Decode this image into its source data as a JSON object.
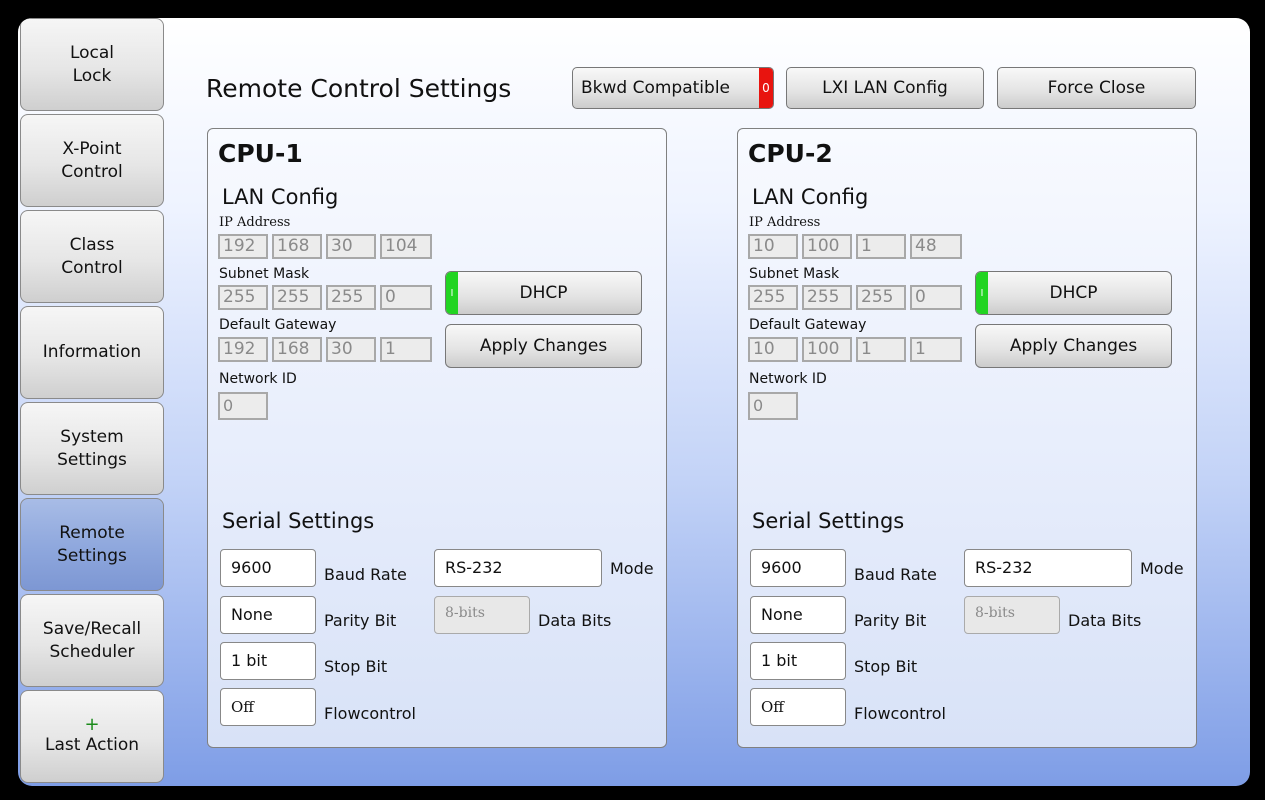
{
  "nav": {
    "items": [
      {
        "label1": "Local",
        "label2": "Lock"
      },
      {
        "label1": "X-Point",
        "label2": "Control"
      },
      {
        "label1": "Class",
        "label2": "Control"
      },
      {
        "label1": "Information",
        "label2": ""
      },
      {
        "label1": "System",
        "label2": "Settings"
      },
      {
        "label1": "Remote",
        "label2": "Settings"
      },
      {
        "label1": "Save/Recall",
        "label2": "Scheduler"
      },
      {
        "label1": "+",
        "label2": "Last Action"
      }
    ],
    "active_index": 5
  },
  "header": {
    "title": "Remote Control Settings",
    "bkwd_label": "Bkwd Compatible",
    "bkwd_indicator": "0",
    "lxi_label": "LXI LAN Config",
    "force_close_label": "Force Close"
  },
  "labels": {
    "lan_config": "LAN Config",
    "ip_address": "IP Address",
    "subnet_mask": "Subnet Mask",
    "default_gateway": "Default Gateway",
    "network_id": "Network ID",
    "dhcp": "DHCP",
    "dhcp_indicator": "I",
    "apply_changes": "Apply Changes",
    "serial_settings": "Serial Settings",
    "baud_rate": "Baud Rate",
    "mode": "Mode",
    "parity_bit": "Parity Bit",
    "data_bits": "Data Bits",
    "stop_bit": "Stop Bit",
    "flowcontrol": "Flowcontrol"
  },
  "cpus": [
    {
      "name": "CPU-1",
      "ip": [
        "192",
        "168",
        "30",
        "104"
      ],
      "subnet": [
        "255",
        "255",
        "255",
        "0"
      ],
      "gateway": [
        "192",
        "168",
        "30",
        "1"
      ],
      "network_id": "0",
      "baud_rate": "9600",
      "mode": "RS-232",
      "parity": "None",
      "data_bits": "8-bits",
      "stop_bit": "1 bit",
      "flowcontrol": "Off"
    },
    {
      "name": "CPU-2",
      "ip": [
        "10",
        "100",
        "1",
        "48"
      ],
      "subnet": [
        "255",
        "255",
        "255",
        "0"
      ],
      "gateway": [
        "10",
        "100",
        "1",
        "1"
      ],
      "network_id": "0",
      "baud_rate": "9600",
      "mode": "RS-232",
      "parity": "None",
      "data_bits": "8-bits",
      "stop_bit": "1 bit",
      "flowcontrol": "Off"
    }
  ],
  "colors": {
    "indicator_red": "#e8140f",
    "indicator_green": "#22d422",
    "active_nav": "#8ea7dd"
  }
}
